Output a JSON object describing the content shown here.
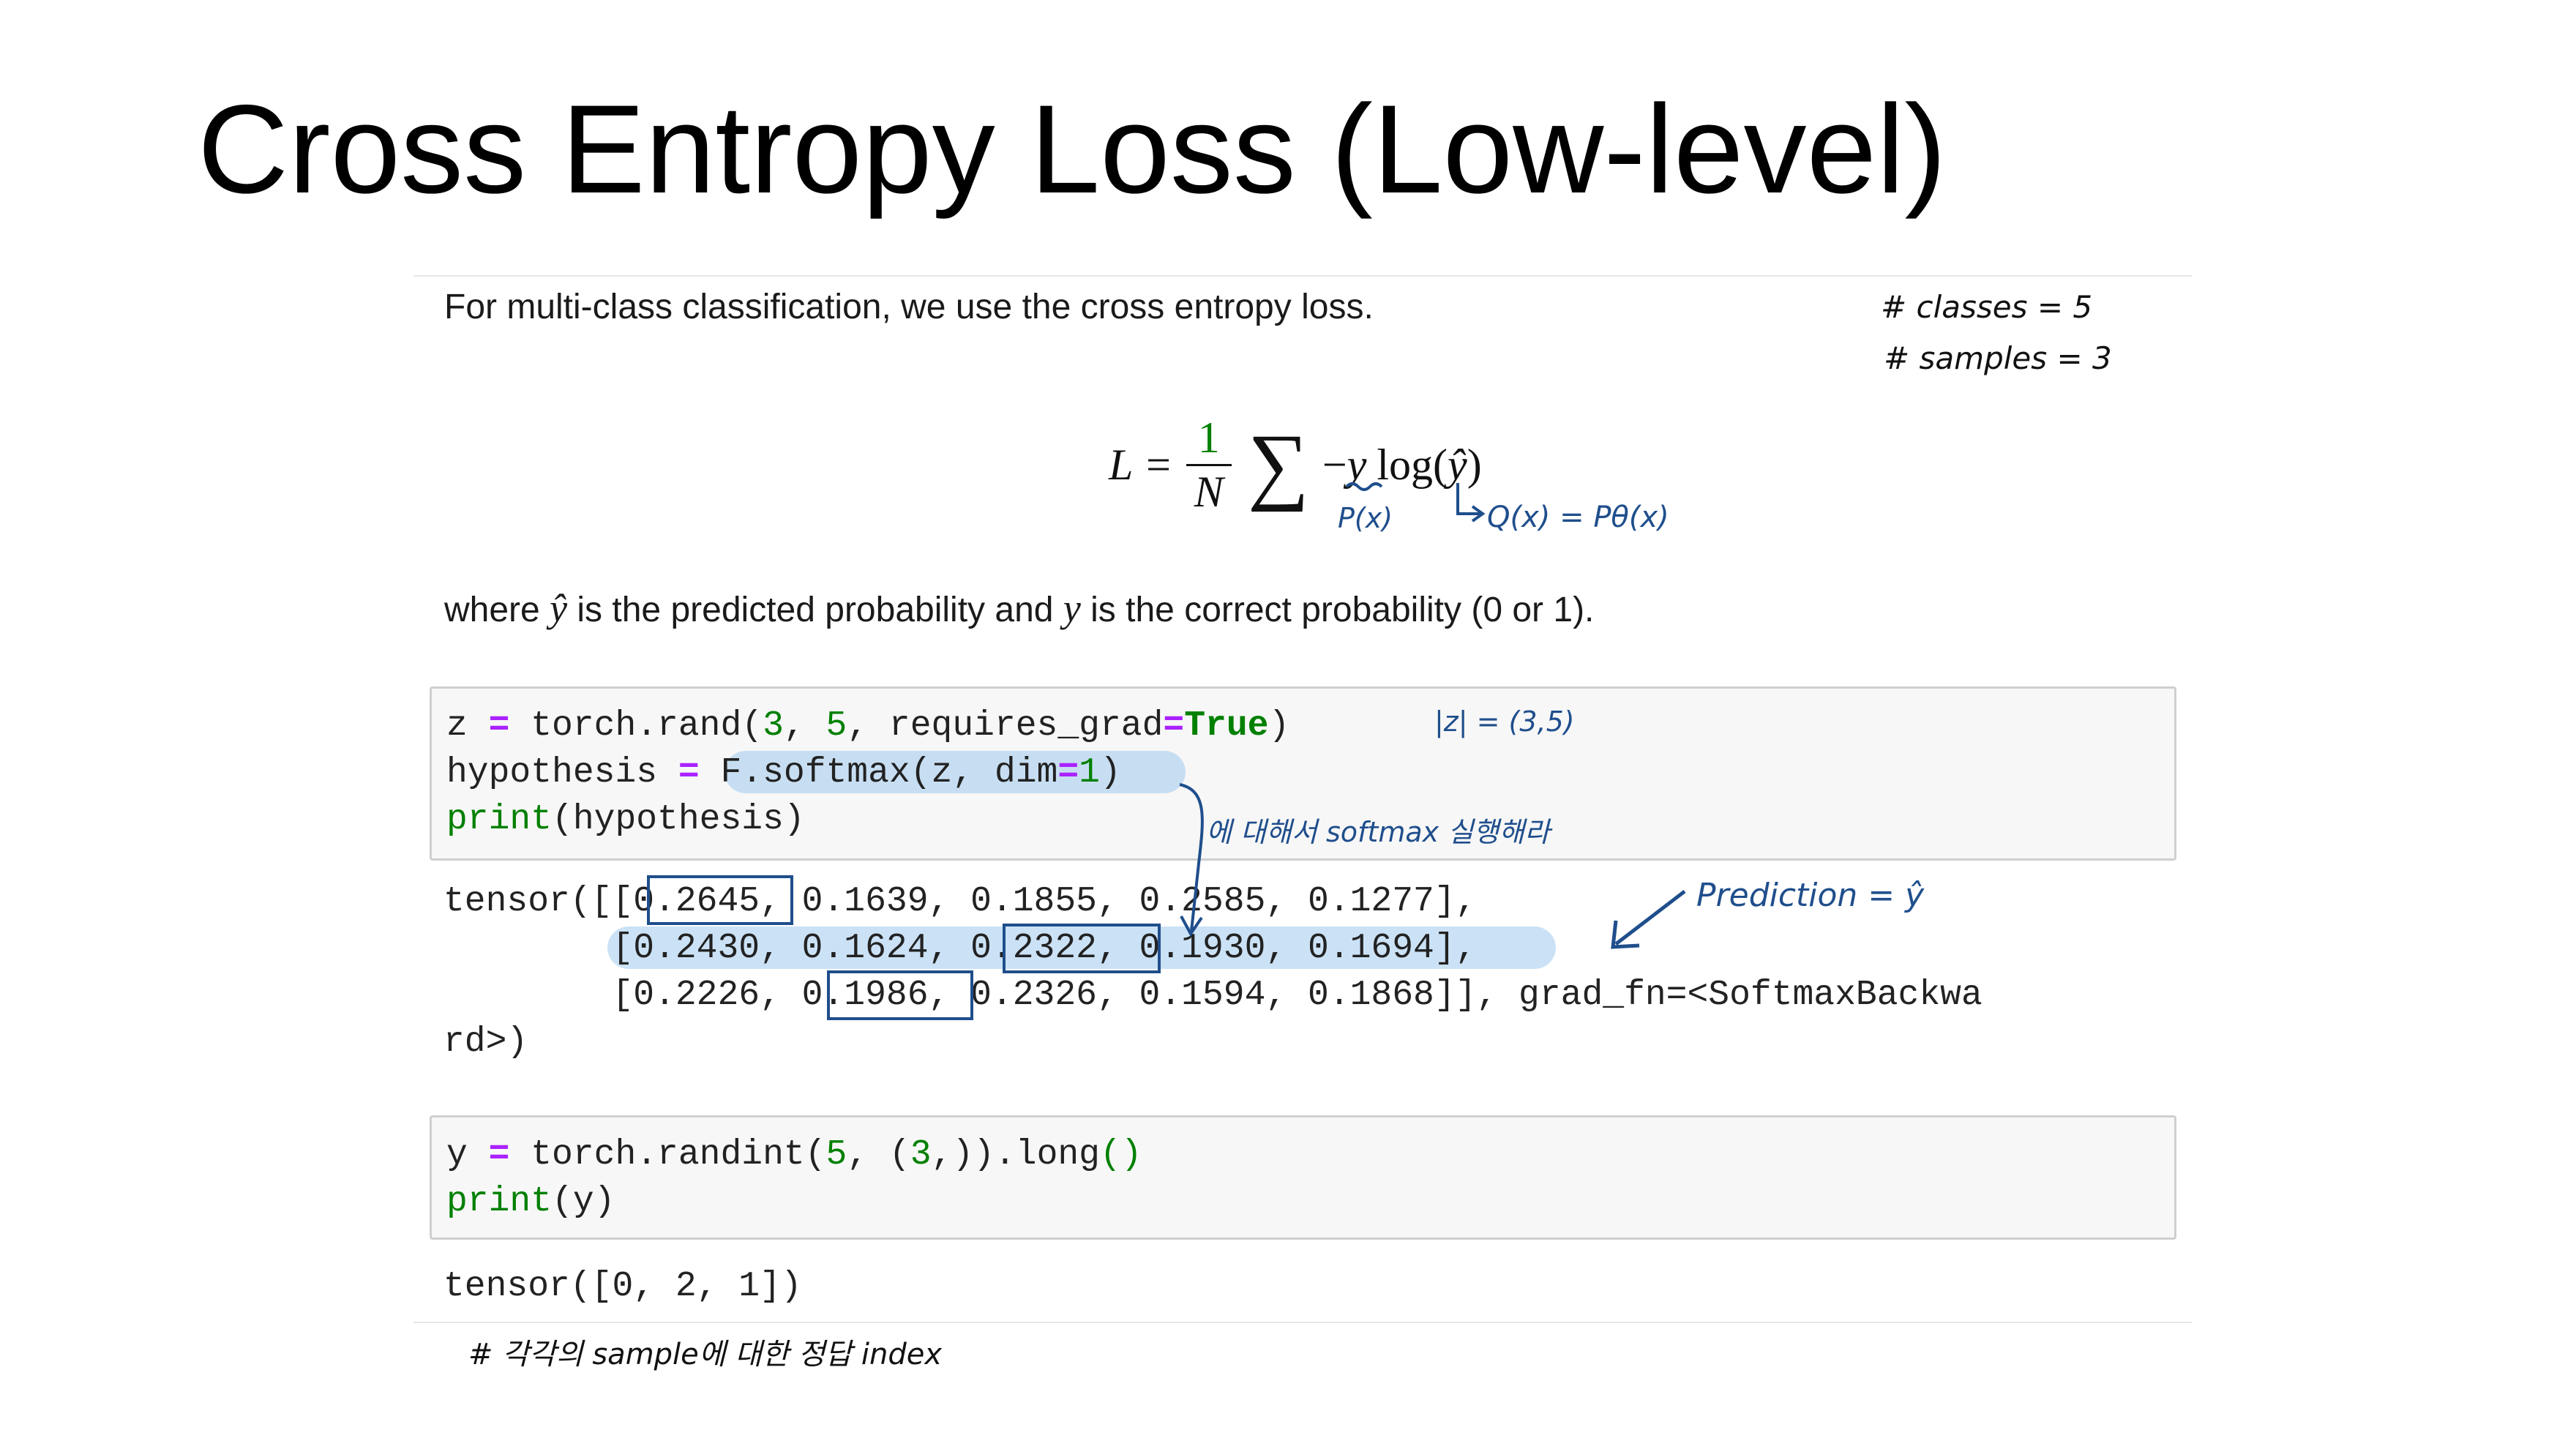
{
  "title": "Cross Entropy Loss (Low-level)",
  "intro": "For multi-class classification, we use the cross entropy loss.",
  "formula": {
    "lhs": "L =",
    "numerator": "1",
    "denominator": "N",
    "sigma": "∑",
    "body_minus": "−",
    "body_y": "y",
    "body_log": "log(",
    "body_yhat": "ŷ",
    "body_close": ")"
  },
  "where": {
    "pre": "where",
    "yhat": "ŷ",
    "mid": "is the predicted probability and",
    "y": "y",
    "post": "is the correct probability (0 or 1)."
  },
  "cell1": {
    "l1_a": "z ",
    "l1_eq": "=",
    "l1_b": " torch.rand(",
    "l1_n1": "3",
    "l1_c": ", ",
    "l1_n2": "5",
    "l1_d": ", requires_grad",
    "l1_eq2": "=",
    "l1_true": "True",
    "l1_e": ")",
    "l2_a": "hypothesis ",
    "l2_eq": "=",
    "l2_b": " F.softmax(z, dim",
    "l2_eq2": "=",
    "l2_n": "1",
    "l2_c": ")",
    "l3_print": "print",
    "l3_b": "(hypothesis)"
  },
  "output1": {
    "line1": "tensor([[0.2645, 0.1639, 0.1855, 0.2585, 0.1277],",
    "line2": "        [0.2430, 0.1624, 0.2322, 0.1930, 0.1694],",
    "line3": "        [0.2226, 0.1986, 0.2326, 0.1594, 0.1868]], grad_fn=<SoftmaxBackwa",
    "line4": "rd>)"
  },
  "cell2": {
    "l1_a": "y ",
    "l1_eq": "=",
    "l1_b": " torch.randint(",
    "l1_n": "5",
    "l1_c": ", (",
    "l1_n2": "3",
    "l1_d": ",)).long",
    "l1_e": "()",
    "l2_print": "print",
    "l2_b": "(y)"
  },
  "output2": {
    "line1": "tensor([0, 2, 1])"
  },
  "annotations": {
    "classes": "# classes = 5",
    "samples": "# samples = 3",
    "p_x": "P(x)",
    "q_x": "Q(x) = Pθ(x)",
    "z_shape": "|z| = (3,5)",
    "softmax_note": "에 대해서 softmax 실행해라",
    "prediction": "Prediction = ŷ",
    "answer_index": "# 각각의 sample에 대한 정답 index"
  },
  "colors": {
    "ink": "#1f4e8c",
    "highlight": "#8cbeeb",
    "keyword": "#008000",
    "operator": "#aa22ff"
  }
}
